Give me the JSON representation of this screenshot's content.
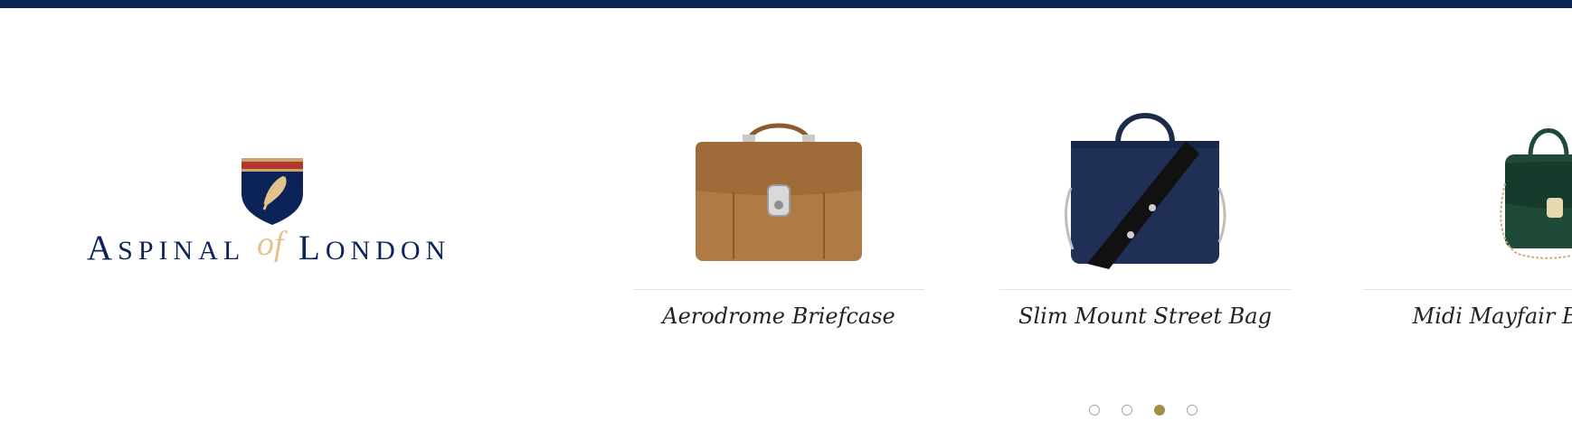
{
  "brand": {
    "logo_left": "Aspinal",
    "logo_of": "of",
    "logo_right": "London",
    "colors": {
      "navy": "#0b2357",
      "gold": "#e2c38b",
      "accent": "#a38e45"
    }
  },
  "carousel": {
    "items": [
      {
        "title": "Aerodrome Briefcase",
        "image": "tan-leather-briefcase"
      },
      {
        "title": "Slim Mount Street Bag",
        "image": "navy-laptop-bag"
      },
      {
        "title": "Midi Mayfair Bag",
        "image": "green-croc-handbag"
      }
    ],
    "dots": {
      "count": 4,
      "active": 3
    }
  }
}
